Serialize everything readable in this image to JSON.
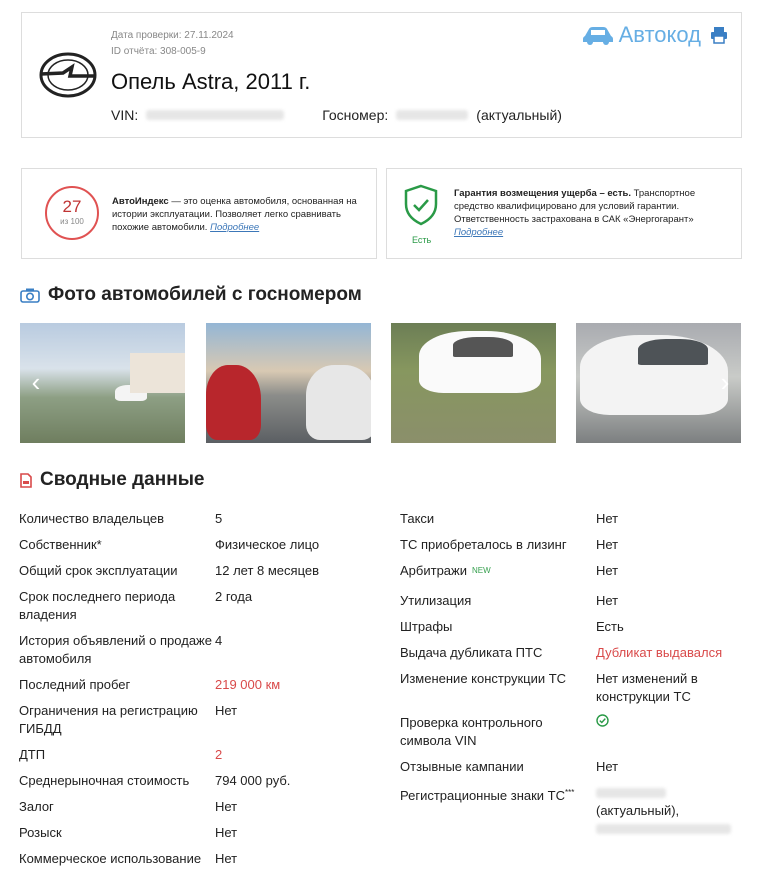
{
  "header": {
    "check_date": "Дата проверки: 27.11.2024",
    "report_id": "ID отчёта: 308-005-9",
    "title": "Опель Astra, 2011 г.",
    "vin_label": "VIN:",
    "regnum_label": "Госномер:",
    "regnum_status": "(актуальный)",
    "brand_name": "Автокод"
  },
  "autoindex": {
    "score": "27",
    "score_sub": "из 100",
    "title": "АвтоИндекс",
    "text": " — это оценка автомобиля, основанная на истории эксплуатации. Позволяет легко сравнивать похожие автомобили. ",
    "link": "Подробнее"
  },
  "guarantee": {
    "badge": "Есть",
    "title": "Гарантия возмещения ущерба – есть.",
    "text": " Транспортное средство квалифицировано для условий гарантии. Ответственность застрахована в САК «Энергогарант» ",
    "link": "Подробнее"
  },
  "photos_section": {
    "title": "Фото автомобилей с госномером"
  },
  "summary_section": {
    "title": "Сводные данные"
  },
  "summary_left": [
    {
      "k": "Количество владельцев",
      "v": "5"
    },
    {
      "k": "Собственник*",
      "v": "Физическое лицо"
    },
    {
      "k": "Общий срок эксплуатации",
      "v": "12 лет 8 месяцев"
    },
    {
      "k": "Срок последнего периода владения",
      "v": "2 года"
    },
    {
      "k": "История объявлений о продаже автомобиля",
      "v": "4"
    },
    {
      "k": "Последний пробег",
      "v": "219 000 км"
    },
    {
      "k": "Ограничения на регистрацию ГИБДД",
      "v": "Нет"
    },
    {
      "k": "ДТП",
      "v": "2"
    },
    {
      "k": "Среднерыночная стоимость",
      "v": "794 000 руб."
    },
    {
      "k": "Залог",
      "v": "Нет"
    },
    {
      "k": "Розыск",
      "v": "Нет"
    },
    {
      "k": "Коммерческое использование",
      "v": "Нет"
    }
  ],
  "summary_right": [
    {
      "k": "Такси",
      "v": "Нет"
    },
    {
      "k": "ТС приобреталось в лизинг",
      "v": "Нет"
    },
    {
      "k": "Арбитражи",
      "badge": "NEW",
      "v": "Нет"
    },
    {
      "k": "Утилизация",
      "v": "Нет"
    },
    {
      "k": "Штрафы",
      "v": "Есть"
    },
    {
      "k": "Выдача дубликата ПТС",
      "v": "Дубликат выдавался"
    },
    {
      "k": "Изменение конструкции ТС",
      "v": "Нет изменений в конструкции ТС"
    },
    {
      "k": "Проверка контрольного символа VIN",
      "v": ""
    },
    {
      "k": "Отзывные кампании",
      "v": "Нет"
    },
    {
      "k": "Регистрационные знаки ТС",
      "sup": "***",
      "v": "(актуальный),"
    }
  ],
  "colors": {
    "accent": "#66aee4",
    "alert": "#d94a4a",
    "ok": "#2a9a47"
  }
}
